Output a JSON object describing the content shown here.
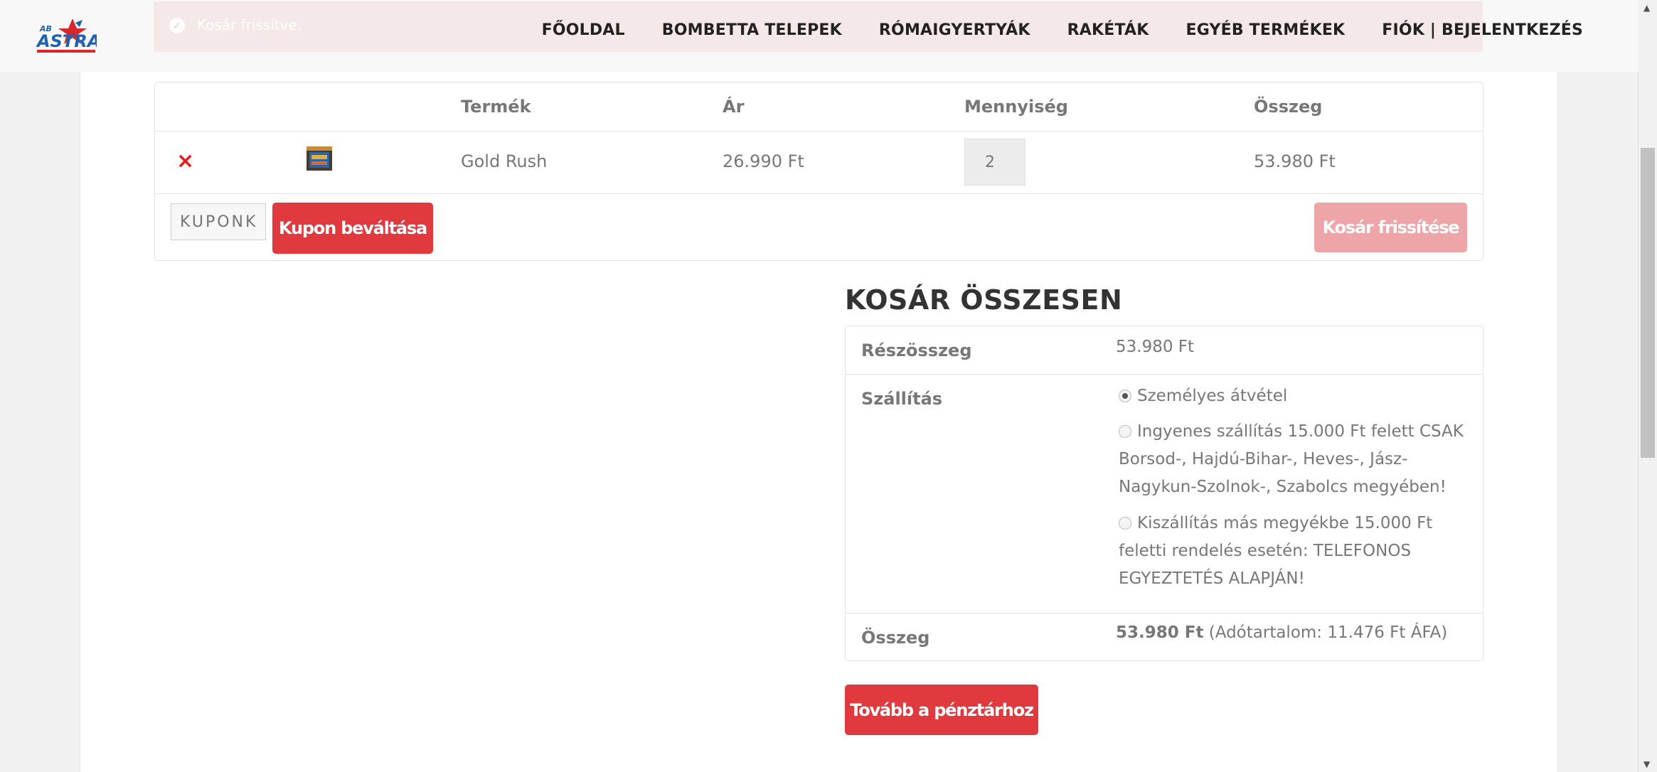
{
  "notice": {
    "text": "Kosár frissítve."
  },
  "logo": {
    "alt": "ASTRA"
  },
  "nav": {
    "items": [
      {
        "label": "FŐOLDAL"
      },
      {
        "label": "BOMBETTA TELEPEK"
      },
      {
        "label": "RÓMAIGYERTYÁK"
      },
      {
        "label": "RAKÉTÁK"
      },
      {
        "label": "EGYÉB TERMÉKEK"
      },
      {
        "label": "FIÓK | BEJELENTKEZÉS"
      }
    ]
  },
  "cart": {
    "headers": {
      "product": "Termék",
      "price": "Ár",
      "quantity": "Mennyiség",
      "subtotal": "Összeg"
    },
    "items": [
      {
        "name": "Gold Rush",
        "price": "26.990 Ft",
        "quantity": "2",
        "subtotal": "53.980 Ft",
        "remove": "×"
      }
    ],
    "coupon_placeholder": "KUPONK",
    "apply_coupon_label": "Kupon beváltása",
    "update_cart_label": "Kosár frissítése"
  },
  "totals": {
    "title": "KOSÁR ÖSSZESEN",
    "subtotal_label": "Részösszeg",
    "subtotal_value": "53.980 Ft",
    "shipping_label": "Szállítás",
    "shipping_options": [
      {
        "label": "Személyes átvétel",
        "checked": true
      },
      {
        "label": "Ingyenes szállítás 15.000 Ft felett CSAK Borsod-, Hajdú-Bihar-, Heves-, Jász-Nagykun-Szolnok-, Szabolcs megyében!",
        "checked": false
      },
      {
        "label": "Kiszállítás más megyékbe 15.000 Ft feletti rendelés esetén: TELEFONOS EGYEZTETÉS ALAPJÁN!",
        "checked": false
      }
    ],
    "total_label": "Összeg",
    "total_value": "53.980 Ft",
    "tax_note": "(Adótartalom: 11.476 Ft ÁFA)",
    "checkout_label": "Tovább a pénztárhoz"
  },
  "colors": {
    "accent": "#e0393e",
    "accent_disabled": "#eda5a8",
    "remove": "#e01c1c"
  }
}
